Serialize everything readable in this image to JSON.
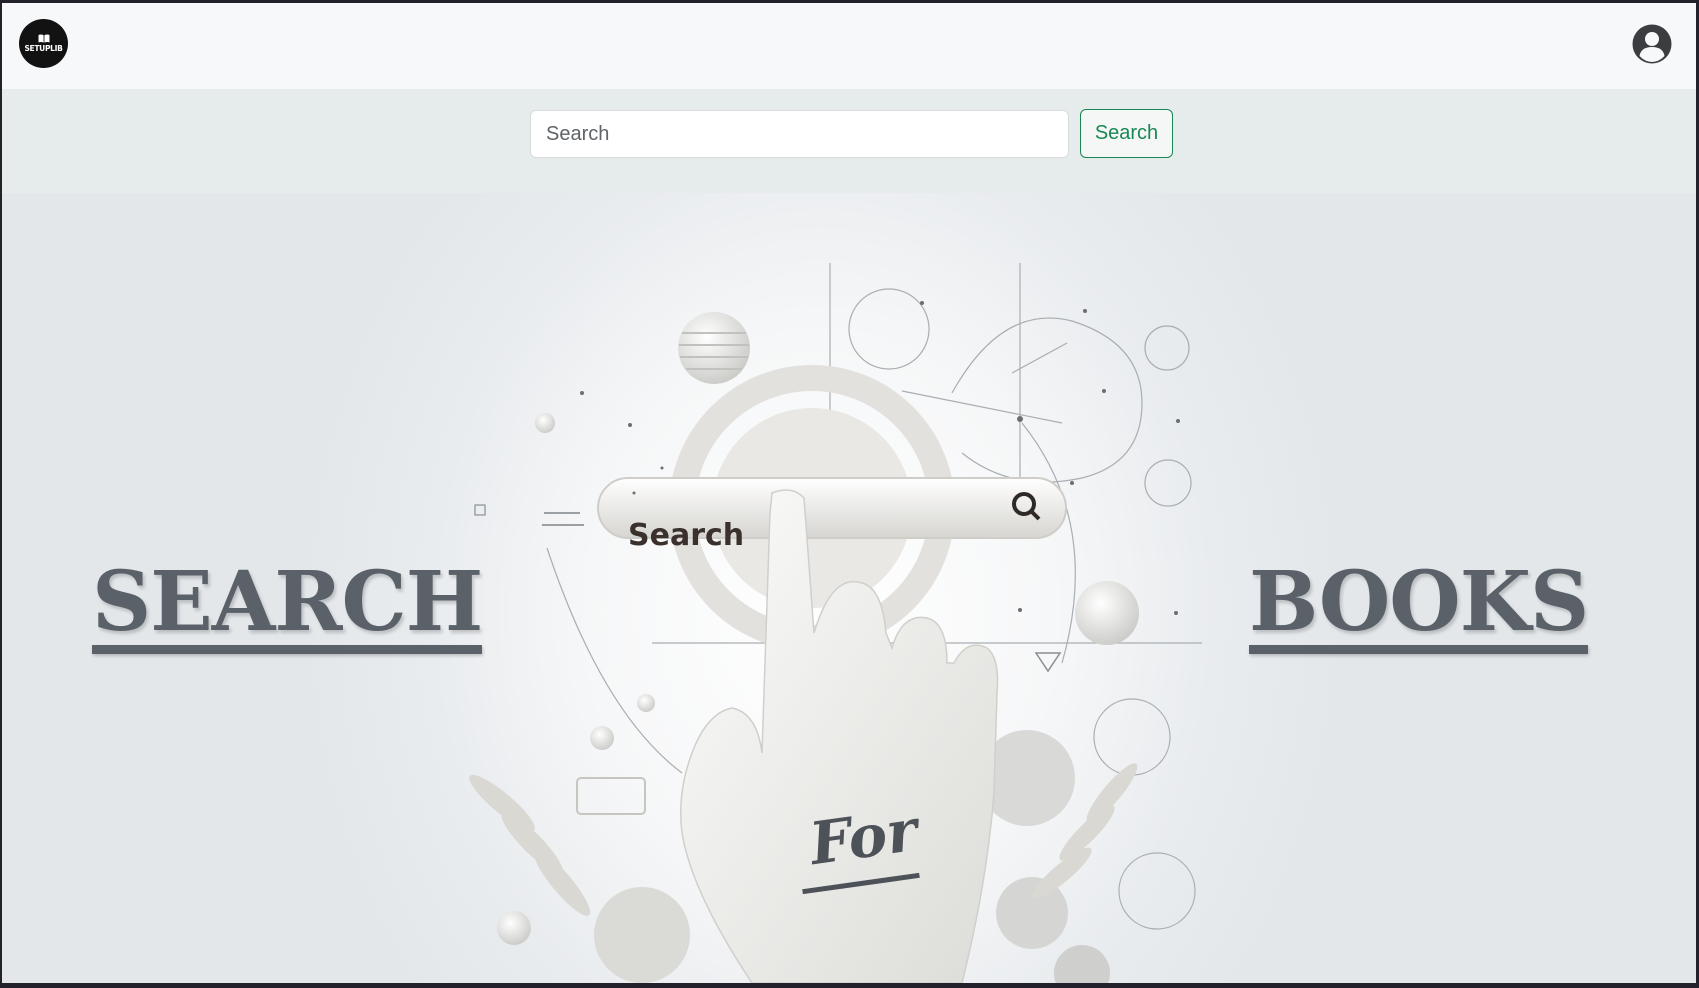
{
  "navbar": {
    "logo_text": "SETUPLIB",
    "profile_icon": "user-circle-icon"
  },
  "search": {
    "placeholder": "Search",
    "button_label": "Search"
  },
  "hero": {
    "left_word": "SEARCH",
    "middle_word": "For",
    "right_word": "BOOKS",
    "art_searchbar_text": "Search",
    "art_searchbar_icon": "magnifier-icon"
  },
  "colors": {
    "accent": "#198754",
    "hero_text": "#5b6168",
    "logo_bg": "#121212"
  }
}
